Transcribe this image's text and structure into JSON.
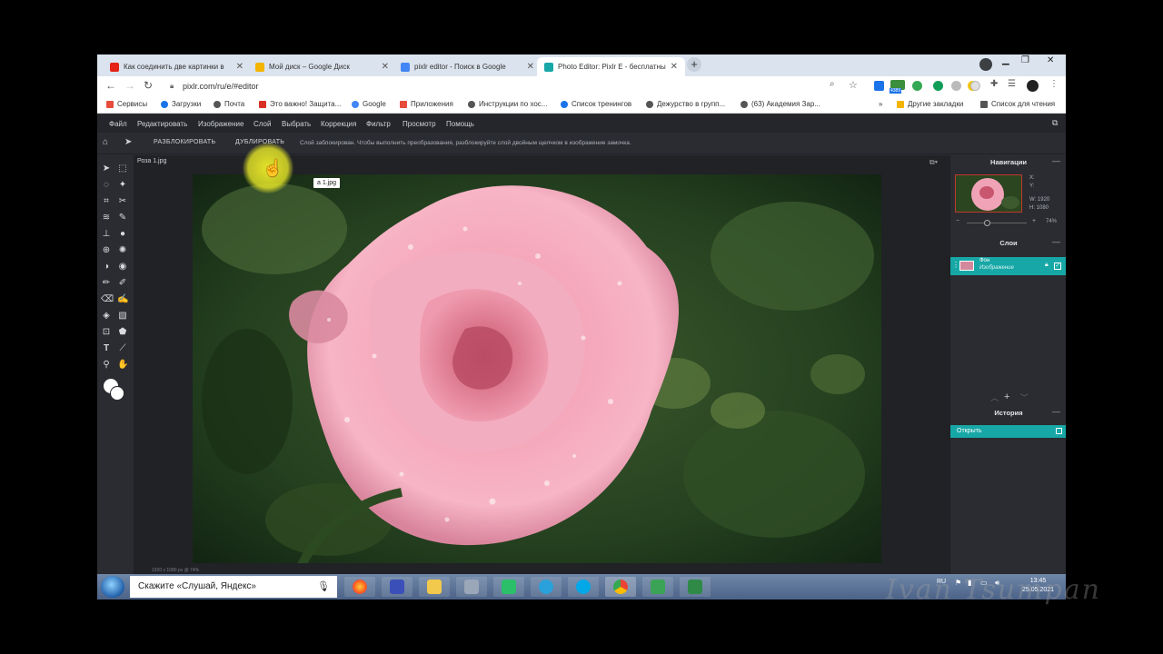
{
  "browser": {
    "tabs": [
      {
        "title": "Как соединить две картинки в",
        "favicon_color": "#e62117",
        "icon": "youtube-icon"
      },
      {
        "title": "Мой диск – Google Диск",
        "favicon_color": "#f4b400",
        "icon": "google-drive-icon"
      },
      {
        "title": "pixlr editor - Поиск в Google",
        "favicon_color": "#4285f4",
        "icon": "google-icon"
      },
      {
        "title": "Photo Editor: Pixlr E - бесплатны",
        "favicon_color": "#17a7a6",
        "icon": "pixlr-icon"
      }
    ],
    "url": "pixlr.com/ru/e/#editor",
    "bookmarks": [
      {
        "label": "Сервисы",
        "color": "#e74c3c"
      },
      {
        "label": "Загрузки",
        "color": "#1a73e8"
      },
      {
        "label": "Почта",
        "color": "#555"
      },
      {
        "label": "Это важно! Защита...",
        "color": "#d93025"
      },
      {
        "label": "Google",
        "color": "#4285f4"
      },
      {
        "label": "Приложения",
        "color": "#e74c3c"
      },
      {
        "label": "Инструкции по хос...",
        "color": "#555"
      },
      {
        "label": "Список тренингов",
        "color": "#1a73e8"
      },
      {
        "label": "Дежурство в групп...",
        "color": "#555"
      },
      {
        "label": "(63) Академия Зар...",
        "color": "#555"
      }
    ],
    "other_bookmarks": "Другие закладки",
    "reading_list": "Список для чтения",
    "badge": "4389"
  },
  "pixlr": {
    "menu": [
      "Файл",
      "Редактировать",
      "Изображение",
      "Слой",
      "Выбрать",
      "Коррекция",
      "Фильтр",
      "Просмотр",
      "Помощь"
    ],
    "options": {
      "unlock": "РАЗБЛОКИРОВАТЬ",
      "duplicate": "ДУБЛИРОВАТЬ",
      "hint": "Слой заблокирован. Чтобы выполнить преобразования, разблокируйте слой двойным щелчком в изображение замочка."
    },
    "document": {
      "tab": "Роза 1.jpg",
      "tooltip": "а 1.jpg",
      "info": "1920 x 1080 px @ 74%"
    },
    "navigation": {
      "title": "Навигации",
      "x_label": "X:",
      "y_label": "Y:",
      "w": "W: 1920",
      "h": "H: 1080",
      "zoom": "74%"
    },
    "layers": {
      "title": "Слои",
      "items": [
        {
          "name": "Фон",
          "type": "Изображение"
        }
      ]
    },
    "history": {
      "title": "История",
      "items": [
        "Открыть"
      ]
    }
  },
  "taskbar": {
    "search_placeholder": "Скажите «Слушай, Яндекс»",
    "lang": "RU",
    "time": "13:45",
    "date": "25.05.2021"
  },
  "watermark": "Ivan Tsumpan"
}
